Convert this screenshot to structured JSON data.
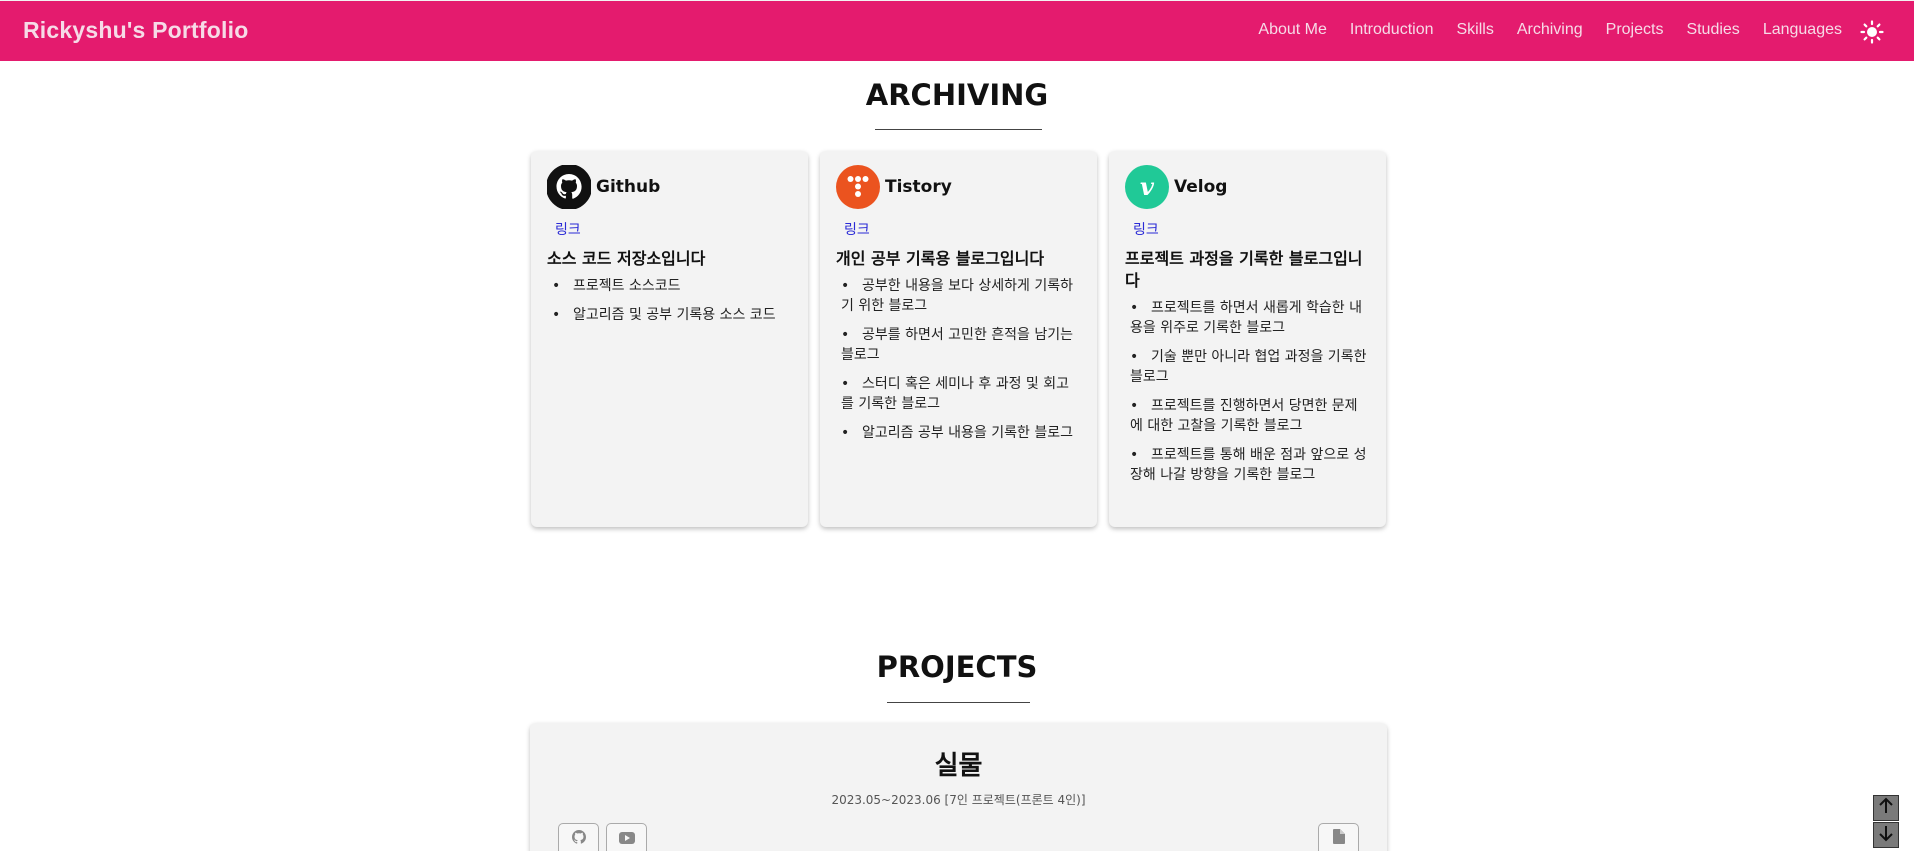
{
  "header": {
    "brand": "Rickyshu's Portfolio",
    "nav": [
      "About Me",
      "Introduction",
      "Skills",
      "Archiving",
      "Projects",
      "Studies",
      "Languages"
    ],
    "theme_icon": "sun-icon"
  },
  "archiving": {
    "title": "ARCHIVING",
    "cards": [
      {
        "name": "Github",
        "icon": "github-icon",
        "link": "링크",
        "desc": "소스 코드 저장소입니다",
        "items": [
          "프로젝트 소스코드",
          "알고리즘 및 공부 기록용 소스 코드"
        ]
      },
      {
        "name": "Tistory",
        "icon": "tistory-icon",
        "link": "링크",
        "desc": "개인 공부 기록용 블로그입니다",
        "items": [
          "공부한 내용을 보다 상세하게 기록하기 위한 블로그",
          "공부를 하면서 고민한 흔적을 남기는 블로그",
          "스터디 혹은 세미나 후 과정 및 회고를 기록한 블로그",
          "알고리즘 공부 내용을 기록한 블로그"
        ]
      },
      {
        "name": "Velog",
        "icon": "velog-icon",
        "link": "링크",
        "desc": "프로젝트 과정을 기록한 블로그입니다",
        "items": [
          "프로젝트를 하면서 새롭게 학습한 내용을 위주로 기록한 블로그",
          "기술 뿐만 아니라 협업 과정을 기록한 블로그",
          "프로젝트를 진행하면서 당면한 문제에 대한 고찰을 기록한 블로그",
          "프로젝트를 통해 배운 점과 앞으로 성장해 나갈 방향을 기록한 블로그"
        ]
      }
    ]
  },
  "projects": {
    "title": "PROJECTS",
    "first": {
      "title": "실물",
      "meta": "2023.05~2023.06 [7인 프로젝트(프론트 4인)]"
    }
  },
  "colors": {
    "header_bg": "#e41b6e",
    "card_bg": "#f3f3f3",
    "link": "#2a2ad6"
  }
}
